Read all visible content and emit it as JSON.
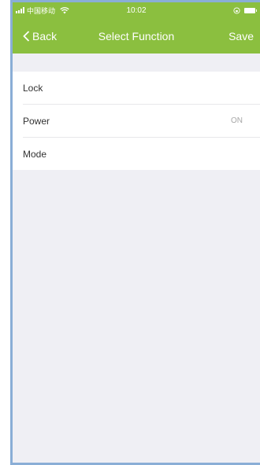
{
  "status_bar": {
    "carrier": "中国移动",
    "time": "10:02"
  },
  "nav": {
    "back_label": "Back",
    "title": "Select Function",
    "save_label": "Save"
  },
  "functions": [
    {
      "label": "Lock",
      "value": ""
    },
    {
      "label": "Power",
      "value": "ON"
    },
    {
      "label": "Mode",
      "value": ""
    }
  ],
  "colors": {
    "header": "#8bbf3f",
    "background": "#efeff4",
    "value_text": "#a7a7a7"
  }
}
